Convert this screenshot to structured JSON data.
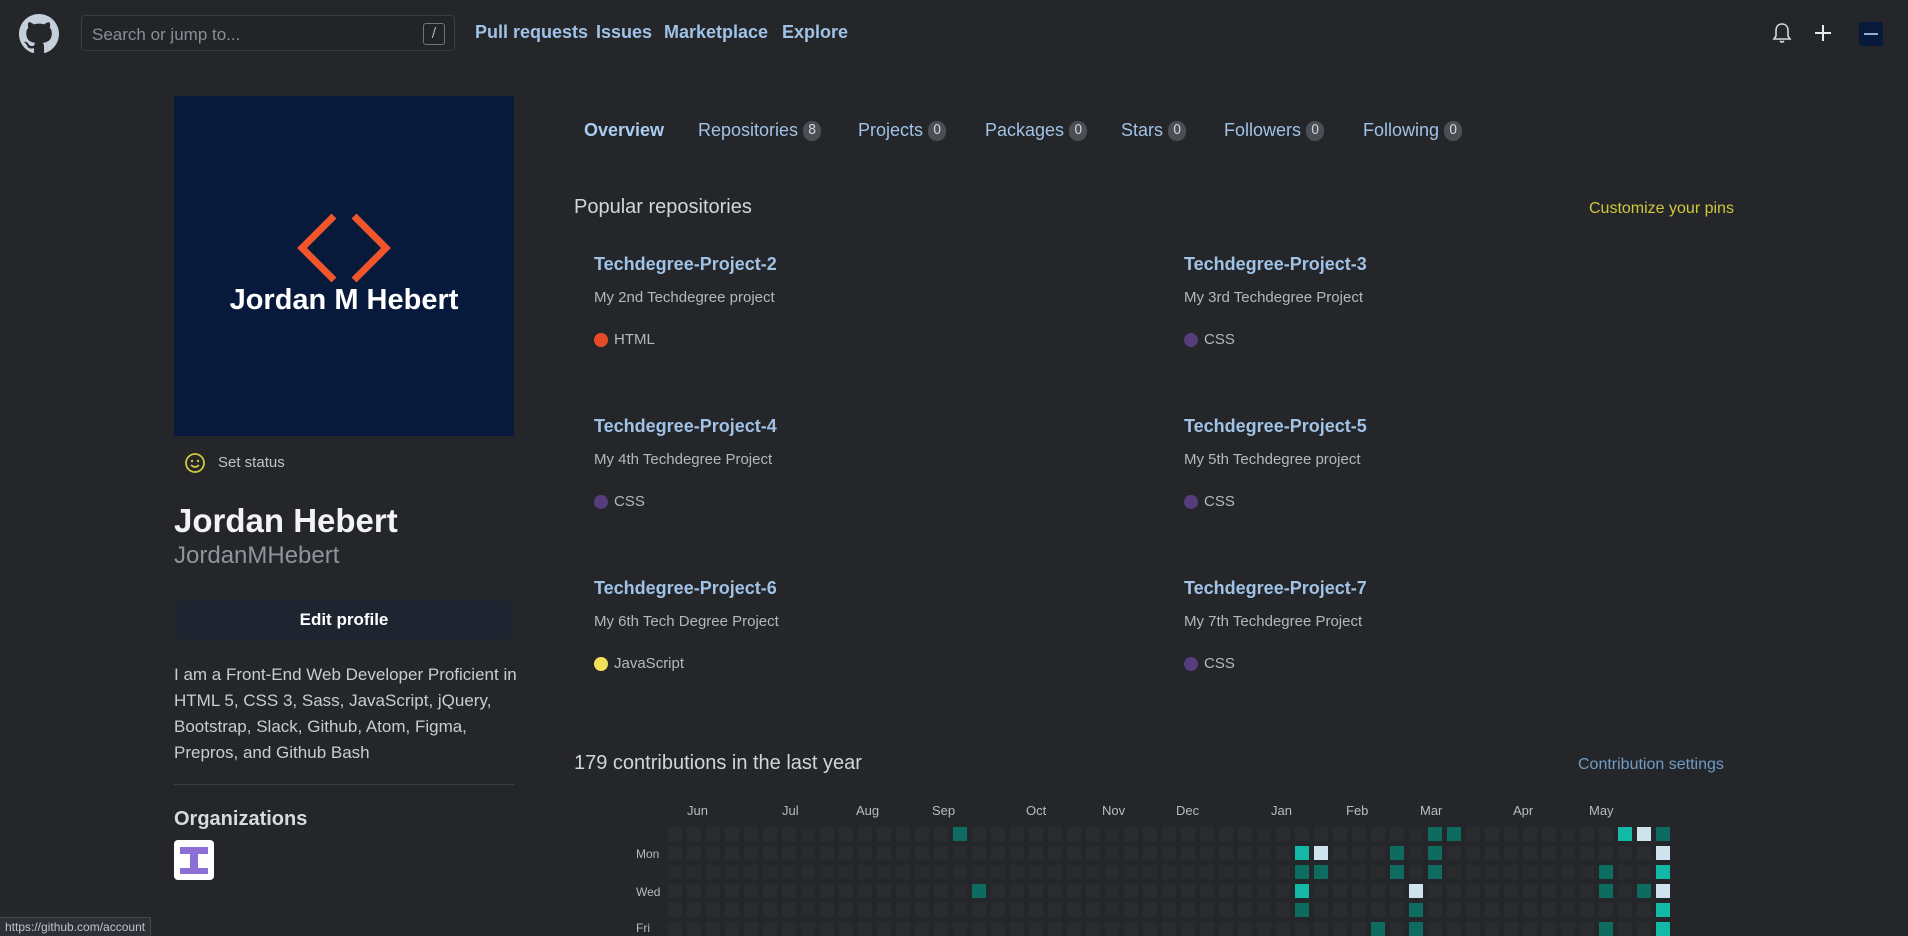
{
  "header": {
    "search_placeholder": "Search or jump to...",
    "search_shortcut": "/",
    "nav": [
      "Pull requests",
      "Issues",
      "Marketplace",
      "Explore"
    ]
  },
  "profile": {
    "avatar_text": "Jordan M Hebert",
    "status_label": "Set status",
    "full_name": "Jordan Hebert",
    "login": "JordanMHebert",
    "edit_button": "Edit profile",
    "bio": "I am a Front-End Web Developer Proficient in HTML 5, CSS 3, Sass, JavaScript, jQuery, Bootstrap, Slack, Github, Atom, Figma, Prepros, and Github Bash",
    "organizations_title": "Organizations"
  },
  "tabs": [
    {
      "label": "Overview",
      "count": ""
    },
    {
      "label": "Repositories",
      "count": "8"
    },
    {
      "label": "Projects",
      "count": "0"
    },
    {
      "label": "Packages",
      "count": "0"
    },
    {
      "label": "Stars",
      "count": "0"
    },
    {
      "label": "Followers",
      "count": "0"
    },
    {
      "label": "Following",
      "count": "0"
    }
  ],
  "popular": {
    "title": "Popular repositories",
    "customize": "Customize your pins",
    "repos": [
      {
        "name": "Techdegree-Project-2",
        "desc": "My 2nd Techdegree project",
        "lang": "HTML",
        "color": "#e34c26"
      },
      {
        "name": "Techdegree-Project-3",
        "desc": "My 3rd Techdegree Project",
        "lang": "CSS",
        "color": "#563d7c"
      },
      {
        "name": "Techdegree-Project-4",
        "desc": "My 4th Techdegree Project",
        "lang": "CSS",
        "color": "#563d7c"
      },
      {
        "name": "Techdegree-Project-5",
        "desc": "My 5th Techdegree project",
        "lang": "CSS",
        "color": "#563d7c"
      },
      {
        "name": "Techdegree-Project-6",
        "desc": "My 6th Tech Degree Project",
        "lang": "JavaScript",
        "color": "#f1e05a"
      },
      {
        "name": "Techdegree-Project-7",
        "desc": "My 7th Techdegree Project",
        "lang": "CSS",
        "color": "#563d7c"
      }
    ]
  },
  "contributions": {
    "title": "179 contributions in the last year",
    "settings": "Contribution settings",
    "months": [
      "Jun",
      "Jul",
      "Aug",
      "Sep",
      "Oct",
      "Nov",
      "Dec",
      "Jan",
      "Feb",
      "Mar",
      "Apr",
      "May"
    ],
    "days": [
      "Mon",
      "Wed",
      "Fri"
    ],
    "colors": {
      "empty": "#2a2b2f",
      "l1": "#0d6b5f",
      "l2": "#0e8a78",
      "l3": "#14b8a6",
      "l4": "#cfe3ee"
    }
  },
  "statusbar": "https://github.com/account"
}
